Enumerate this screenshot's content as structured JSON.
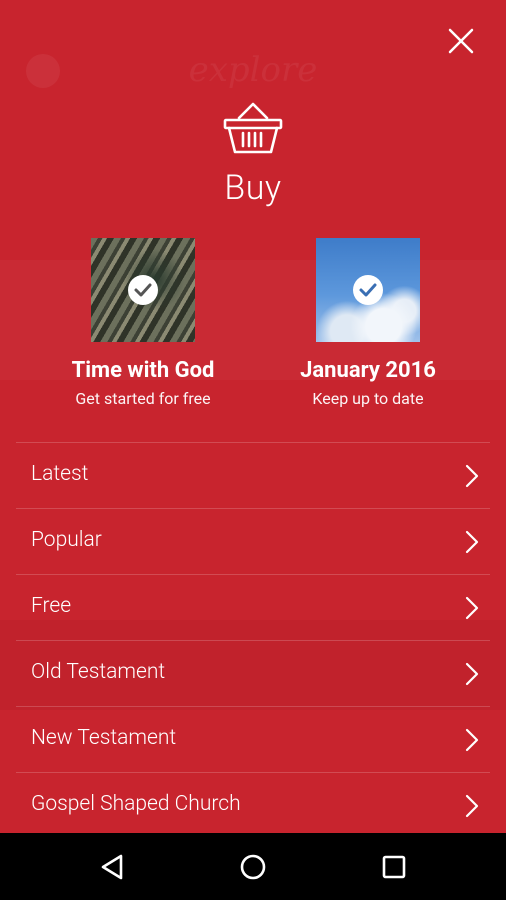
{
  "background": {
    "brand_text": "explore"
  },
  "header": {
    "title": "Buy"
  },
  "featured": [
    {
      "title": "Time with God",
      "subtitle": "Get started for free"
    },
    {
      "title": "January 2016",
      "subtitle": "Keep up to date"
    }
  ],
  "menu": {
    "items": [
      {
        "label": "Latest"
      },
      {
        "label": "Popular"
      },
      {
        "label": "Free"
      },
      {
        "label": "Old Testament"
      },
      {
        "label": "New Testament"
      },
      {
        "label": "Gospel Shaped Church"
      }
    ]
  },
  "colors": {
    "background": "#c8242e",
    "text": "#ffffff",
    "navbar": "#000000"
  },
  "icons": {
    "close": "close-icon",
    "basket": "basket-icon",
    "check": "check-circle-icon",
    "chevron": "chevron-right-icon",
    "back": "back-icon",
    "home": "home-icon",
    "recents": "recents-icon"
  }
}
